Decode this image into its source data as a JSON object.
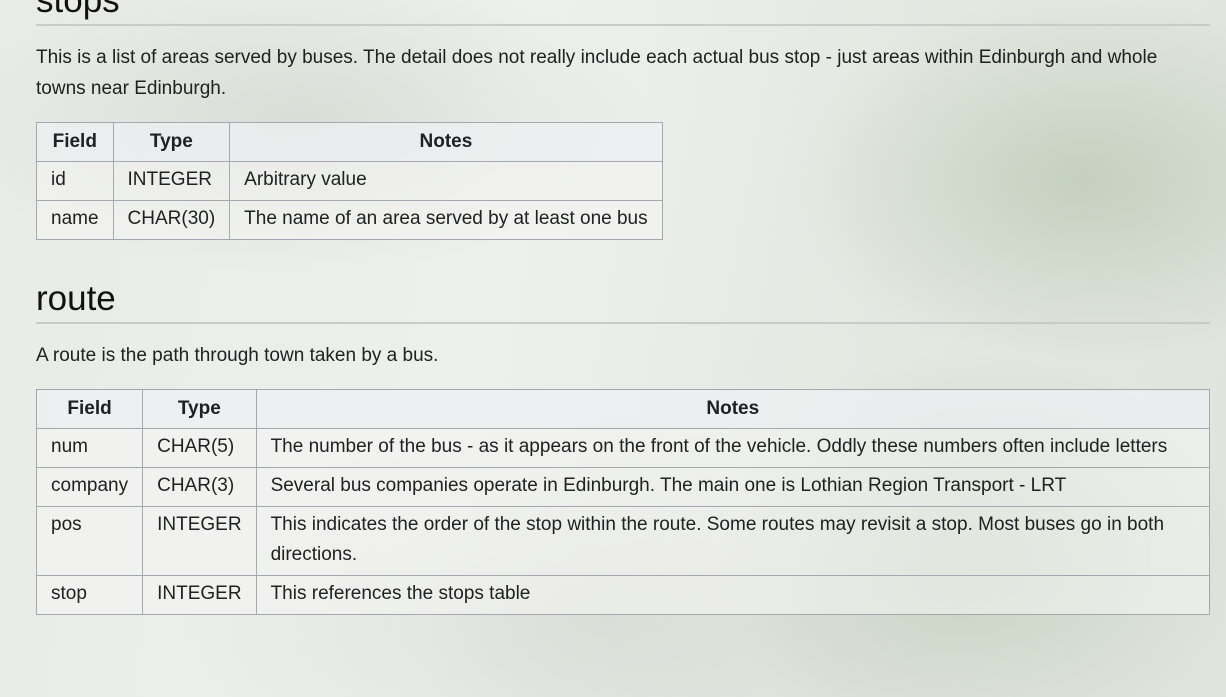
{
  "sections": {
    "stops": {
      "heading": "stops",
      "description": "This is a list of areas served by buses. The detail does not really include each actual bus stop - just areas within Edinburgh and whole towns near Edinburgh.",
      "headers": [
        "Field",
        "Type",
        "Notes"
      ],
      "rows": [
        {
          "field": "id",
          "type": "INTEGER",
          "notes": "Arbitrary value"
        },
        {
          "field": "name",
          "type": "CHAR(30)",
          "notes": "The name of an area served by at least one bus"
        }
      ]
    },
    "route": {
      "heading": "route",
      "description": "A route is the path through town taken by a bus.",
      "headers": [
        "Field",
        "Type",
        "Notes"
      ],
      "rows": [
        {
          "field": "num",
          "type": "CHAR(5)",
          "notes": "The number of the bus - as it appears on the front of the vehicle. Oddly these numbers often include letters"
        },
        {
          "field": "company",
          "type": "CHAR(3)",
          "notes": "Several bus companies operate in Edinburgh. The main one is Lothian Region Transport - LRT"
        },
        {
          "field": "pos",
          "type": "INTEGER",
          "notes": "This indicates the order of the stop within the route. Some routes may revisit a stop. Most buses go in both directions."
        },
        {
          "field": "stop",
          "type": "INTEGER",
          "notes": "This references the stops table"
        }
      ]
    }
  }
}
